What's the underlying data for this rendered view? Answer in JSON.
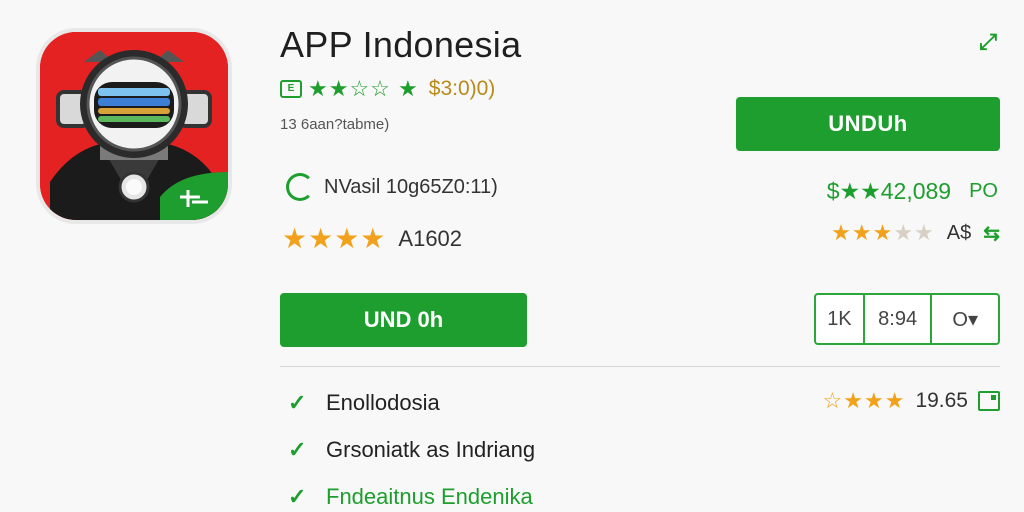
{
  "app": {
    "title": "APP Indonesia",
    "subtitle": "13 6aan?tabme)"
  },
  "rating_top": {
    "count": "$3:0)0)"
  },
  "install_top_label": "UNDUh",
  "info": {
    "text": "NVasil 10g65Z0:11)"
  },
  "price": {
    "value": "$★★42,089",
    "code": "PO"
  },
  "rating_left": {
    "code": "A1602"
  },
  "rating_right": {
    "code": "A$"
  },
  "install_main_label": "UND 0h",
  "segments": [
    "1K",
    "8:94",
    "O▾"
  ],
  "features": [
    {
      "text": "Enollodosia"
    },
    {
      "text": "Grsoniatk as Indriang"
    },
    {
      "text": "Fndeaitnus Endenika"
    }
  ],
  "review": {
    "score": "19.65"
  },
  "colors": {
    "accent": "#1e9e2e",
    "star": "#f2a11c",
    "icon_bg": "#e42222"
  }
}
